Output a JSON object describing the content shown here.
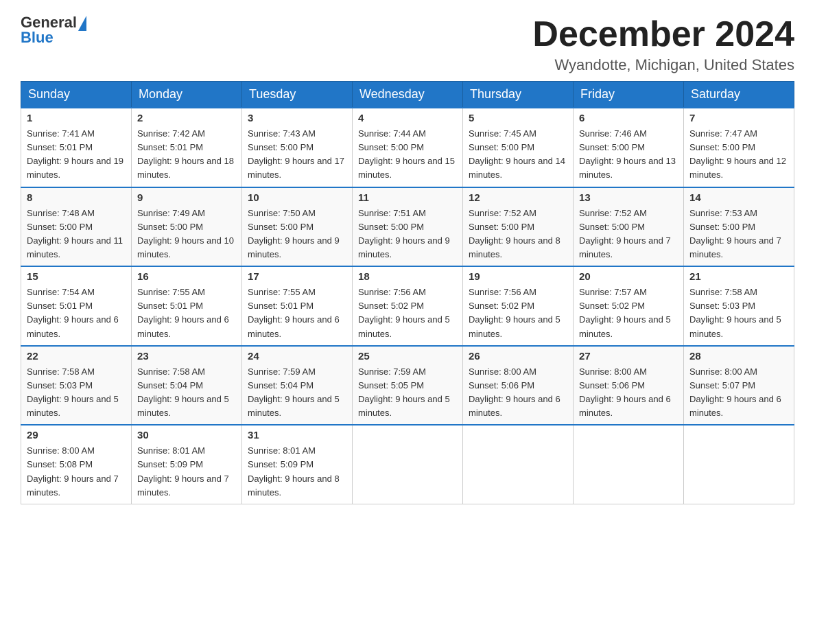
{
  "header": {
    "logo": {
      "general": "General",
      "blue": "Blue"
    },
    "title": "December 2024",
    "location": "Wyandotte, Michigan, United States"
  },
  "weekdays": [
    "Sunday",
    "Monday",
    "Tuesday",
    "Wednesday",
    "Thursday",
    "Friday",
    "Saturday"
  ],
  "weeks": [
    [
      {
        "day": 1,
        "sunrise": "7:41 AM",
        "sunset": "5:01 PM",
        "daylight": "9 hours and 19 minutes."
      },
      {
        "day": 2,
        "sunrise": "7:42 AM",
        "sunset": "5:01 PM",
        "daylight": "9 hours and 18 minutes."
      },
      {
        "day": 3,
        "sunrise": "7:43 AM",
        "sunset": "5:00 PM",
        "daylight": "9 hours and 17 minutes."
      },
      {
        "day": 4,
        "sunrise": "7:44 AM",
        "sunset": "5:00 PM",
        "daylight": "9 hours and 15 minutes."
      },
      {
        "day": 5,
        "sunrise": "7:45 AM",
        "sunset": "5:00 PM",
        "daylight": "9 hours and 14 minutes."
      },
      {
        "day": 6,
        "sunrise": "7:46 AM",
        "sunset": "5:00 PM",
        "daylight": "9 hours and 13 minutes."
      },
      {
        "day": 7,
        "sunrise": "7:47 AM",
        "sunset": "5:00 PM",
        "daylight": "9 hours and 12 minutes."
      }
    ],
    [
      {
        "day": 8,
        "sunrise": "7:48 AM",
        "sunset": "5:00 PM",
        "daylight": "9 hours and 11 minutes."
      },
      {
        "day": 9,
        "sunrise": "7:49 AM",
        "sunset": "5:00 PM",
        "daylight": "9 hours and 10 minutes."
      },
      {
        "day": 10,
        "sunrise": "7:50 AM",
        "sunset": "5:00 PM",
        "daylight": "9 hours and 9 minutes."
      },
      {
        "day": 11,
        "sunrise": "7:51 AM",
        "sunset": "5:00 PM",
        "daylight": "9 hours and 9 minutes."
      },
      {
        "day": 12,
        "sunrise": "7:52 AM",
        "sunset": "5:00 PM",
        "daylight": "9 hours and 8 minutes."
      },
      {
        "day": 13,
        "sunrise": "7:52 AM",
        "sunset": "5:00 PM",
        "daylight": "9 hours and 7 minutes."
      },
      {
        "day": 14,
        "sunrise": "7:53 AM",
        "sunset": "5:00 PM",
        "daylight": "9 hours and 7 minutes."
      }
    ],
    [
      {
        "day": 15,
        "sunrise": "7:54 AM",
        "sunset": "5:01 PM",
        "daylight": "9 hours and 6 minutes."
      },
      {
        "day": 16,
        "sunrise": "7:55 AM",
        "sunset": "5:01 PM",
        "daylight": "9 hours and 6 minutes."
      },
      {
        "day": 17,
        "sunrise": "7:55 AM",
        "sunset": "5:01 PM",
        "daylight": "9 hours and 6 minutes."
      },
      {
        "day": 18,
        "sunrise": "7:56 AM",
        "sunset": "5:02 PM",
        "daylight": "9 hours and 5 minutes."
      },
      {
        "day": 19,
        "sunrise": "7:56 AM",
        "sunset": "5:02 PM",
        "daylight": "9 hours and 5 minutes."
      },
      {
        "day": 20,
        "sunrise": "7:57 AM",
        "sunset": "5:02 PM",
        "daylight": "9 hours and 5 minutes."
      },
      {
        "day": 21,
        "sunrise": "7:58 AM",
        "sunset": "5:03 PM",
        "daylight": "9 hours and 5 minutes."
      }
    ],
    [
      {
        "day": 22,
        "sunrise": "7:58 AM",
        "sunset": "5:03 PM",
        "daylight": "9 hours and 5 minutes."
      },
      {
        "day": 23,
        "sunrise": "7:58 AM",
        "sunset": "5:04 PM",
        "daylight": "9 hours and 5 minutes."
      },
      {
        "day": 24,
        "sunrise": "7:59 AM",
        "sunset": "5:04 PM",
        "daylight": "9 hours and 5 minutes."
      },
      {
        "day": 25,
        "sunrise": "7:59 AM",
        "sunset": "5:05 PM",
        "daylight": "9 hours and 5 minutes."
      },
      {
        "day": 26,
        "sunrise": "8:00 AM",
        "sunset": "5:06 PM",
        "daylight": "9 hours and 6 minutes."
      },
      {
        "day": 27,
        "sunrise": "8:00 AM",
        "sunset": "5:06 PM",
        "daylight": "9 hours and 6 minutes."
      },
      {
        "day": 28,
        "sunrise": "8:00 AM",
        "sunset": "5:07 PM",
        "daylight": "9 hours and 6 minutes."
      }
    ],
    [
      {
        "day": 29,
        "sunrise": "8:00 AM",
        "sunset": "5:08 PM",
        "daylight": "9 hours and 7 minutes."
      },
      {
        "day": 30,
        "sunrise": "8:01 AM",
        "sunset": "5:09 PM",
        "daylight": "9 hours and 7 minutes."
      },
      {
        "day": 31,
        "sunrise": "8:01 AM",
        "sunset": "5:09 PM",
        "daylight": "9 hours and 8 minutes."
      },
      null,
      null,
      null,
      null
    ]
  ]
}
